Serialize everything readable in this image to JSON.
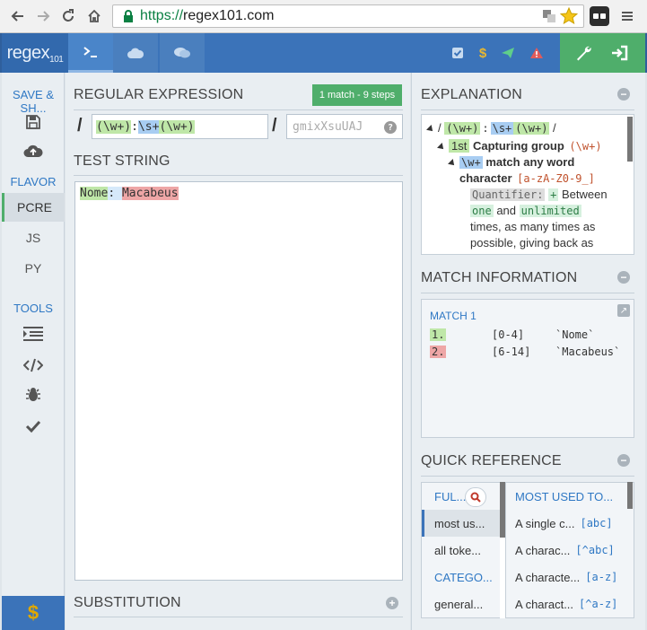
{
  "browser": {
    "url_scheme": "https://",
    "url_host": "regex101.com"
  },
  "header": {
    "logo_main": "regex",
    "logo_sub": "101"
  },
  "sidebar": {
    "save_heading": "SAVE & SH...",
    "flavor_heading": "FLAVOR",
    "flavors": [
      "PCRE",
      "JS",
      "PY"
    ],
    "tools_heading": "TOOLS",
    "donate_symbol": "$"
  },
  "regex": {
    "title": "REGULAR EXPRESSION",
    "badge": "1 match - 9 steps",
    "delimiter": "/",
    "tokens": {
      "g1": "(\\w+)",
      "colon": ":",
      "esc": "\\s+",
      "g2": "(\\w+)"
    },
    "flags_placeholder": "gmixXsuUAJ",
    "help": "?"
  },
  "test": {
    "title": "TEST STRING",
    "part1": "Nome",
    "part2": ": ",
    "part3": "Macabeus"
  },
  "substitution": {
    "title": "SUBSTITUTION"
  },
  "explanation": {
    "title": "EXPLANATION",
    "line_capture_label": "1st",
    "line_capture_text": "Capturing group",
    "line_capture_code": "(\\w+)",
    "line_w_token": "\\w+",
    "line_w_text": "match any word",
    "line_char_text": "character",
    "line_char_code": "[a-zA-Z0-9_]",
    "quant_label": "Quantifier:",
    "quant_plus": "+",
    "quant_between": "Between",
    "quant_one": "one",
    "quant_and": "and",
    "quant_unlimited": "unlimited",
    "quant_rest1": "times, as many times as",
    "quant_rest2": "possible, giving back as"
  },
  "match_info": {
    "title": "MATCH INFORMATION",
    "match_label": "MATCH 1",
    "rows": [
      {
        "num": "1.",
        "range": "[0-4]",
        "value": "`Nome`"
      },
      {
        "num": "2.",
        "range": "[6-14]",
        "value": "`Macabeus`"
      }
    ]
  },
  "quick_ref": {
    "title": "QUICK REFERENCE",
    "left_items": [
      "FUL...",
      "most us...",
      "all toke...",
      "CATEGO...",
      "general..."
    ],
    "right_head": "MOST USED TO...",
    "right_items": [
      {
        "label": "A single c...",
        "token": "[abc]"
      },
      {
        "label": "A charac...",
        "token": "[^abc]"
      },
      {
        "label": "A characte...",
        "token": "[a-z]"
      },
      {
        "label": "A charact...",
        "token": "[^a-z]"
      }
    ]
  }
}
